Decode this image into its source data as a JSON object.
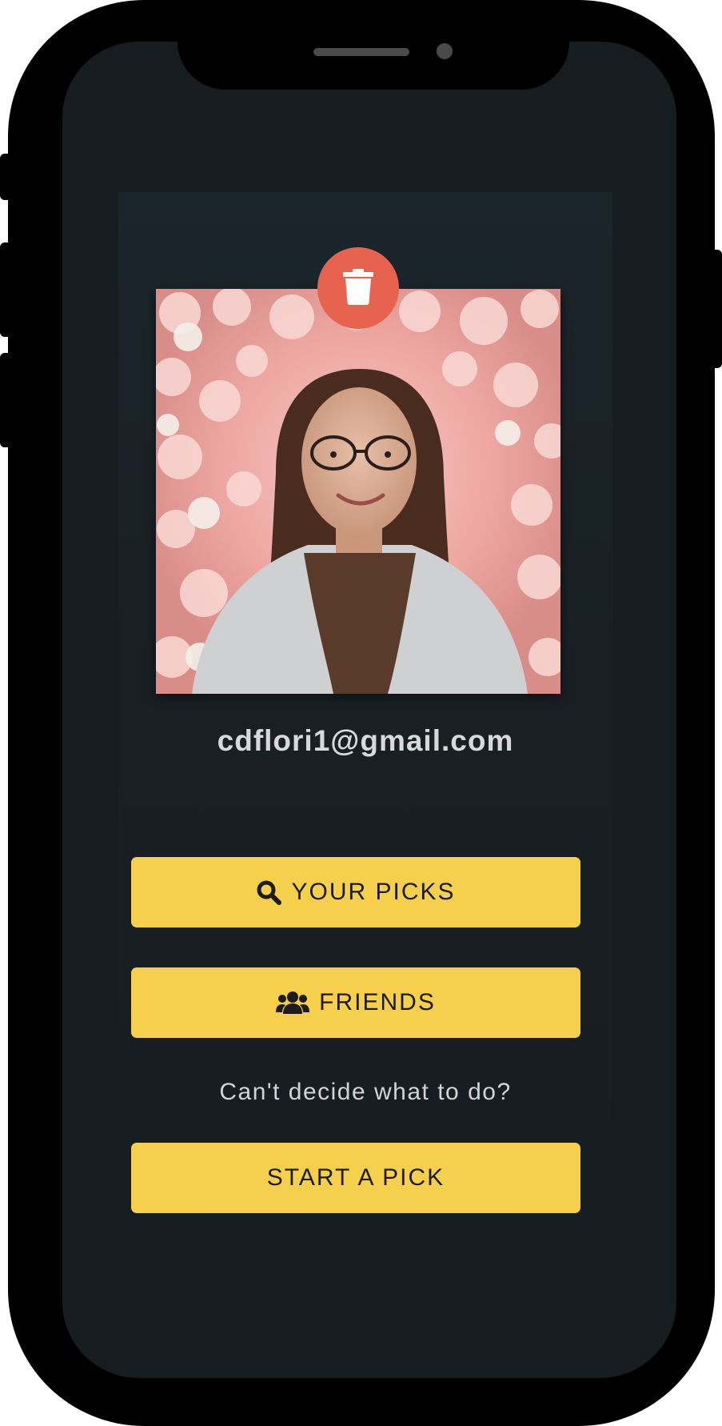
{
  "profile": {
    "email": "cdflori1@gmail.com",
    "photo_alt": "profile photo"
  },
  "actions": {
    "your_picks_label": "YOUR PICKS",
    "friends_label": "FRIENDS",
    "prompt_text": "Can't decide what to do?",
    "start_pick_label": "START A PICK"
  },
  "icons": {
    "delete": "trash-icon",
    "your_picks": "search-icon",
    "friends": "users-icon"
  },
  "colors": {
    "accent": "#f6d04d",
    "delete": "#e8634f",
    "background": "#161d20"
  }
}
